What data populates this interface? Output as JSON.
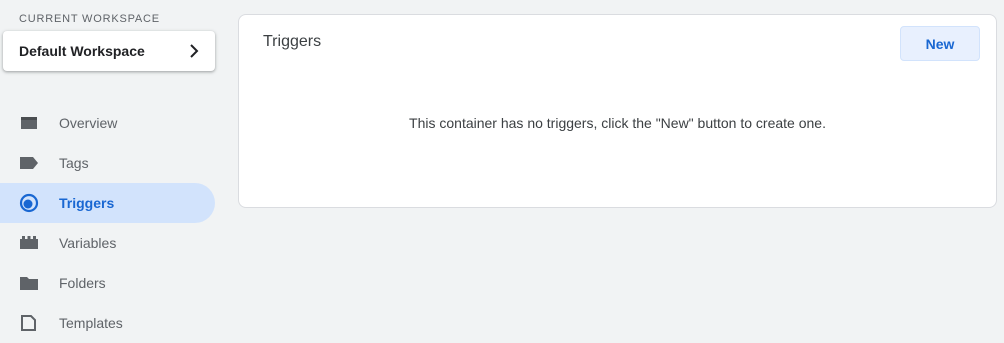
{
  "workspace": {
    "label": "CURRENT WORKSPACE",
    "name": "Default Workspace"
  },
  "nav": {
    "items": [
      {
        "label": "Overview",
        "icon": "overview-icon"
      },
      {
        "label": "Tags",
        "icon": "tag-icon"
      },
      {
        "label": "Triggers",
        "icon": "trigger-icon",
        "active": true
      },
      {
        "label": "Variables",
        "icon": "variables-icon"
      },
      {
        "label": "Folders",
        "icon": "folder-icon"
      },
      {
        "label": "Templates",
        "icon": "template-icon"
      }
    ]
  },
  "main": {
    "title": "Triggers",
    "new_button": "New",
    "empty_message": "This container has no triggers, click the \"New\" button to create one."
  },
  "colors": {
    "accent": "#1967d2",
    "active_bg": "#d2e3fc",
    "page_bg": "#f1f3f4"
  }
}
